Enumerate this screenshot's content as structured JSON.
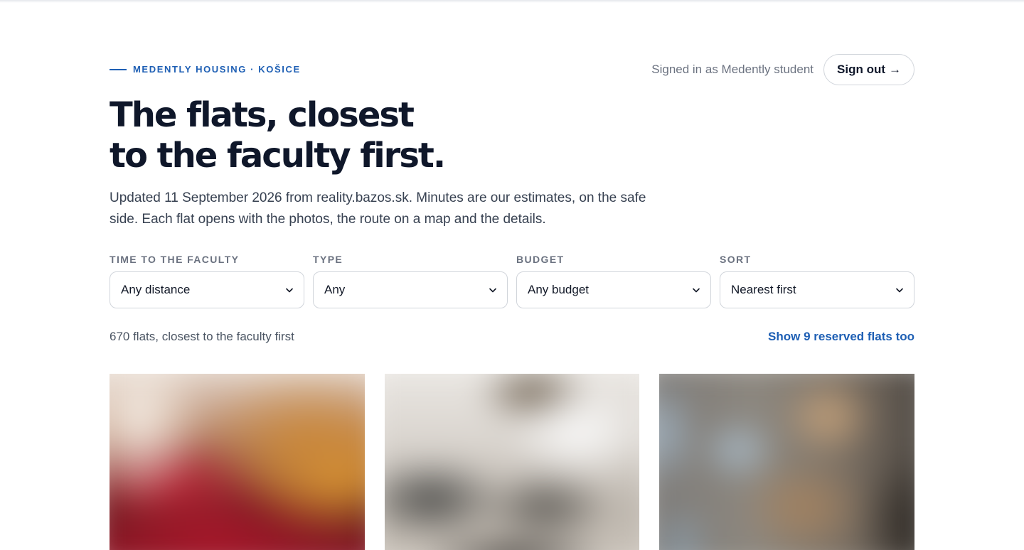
{
  "brand": {
    "eyebrow": "MEDENTLY HOUSING · KOŠICE",
    "accent_color": "#1e5fb4"
  },
  "account": {
    "signed_in_text": "Signed in as Medently student",
    "sign_out_label": "Sign out",
    "sign_out_arrow": "→"
  },
  "hero": {
    "title_line_1": "The flats, closest",
    "title_line_2": "to the faculty first.",
    "lede": "Updated 11 September 2026 from reality.bazos.sk. Minutes are our estimates, on the safe side. Each flat opens with the photos, the route on a map and the details."
  },
  "filters": [
    {
      "label": "TIME TO THE FACULTY",
      "value": "Any distance"
    },
    {
      "label": "TYPE",
      "value": "Any"
    },
    {
      "label": "BUDGET",
      "value": "Any budget"
    },
    {
      "label": "SORT",
      "value": "Nearest first"
    }
  ],
  "results": {
    "count_text": "670 flats, closest to the faculty first",
    "reserved_link": "Show 9 reserved flats too"
  },
  "cards": [
    {
      "photo": "flat-photo-1"
    },
    {
      "photo": "flat-photo-2"
    },
    {
      "photo": "flat-photo-3"
    }
  ]
}
